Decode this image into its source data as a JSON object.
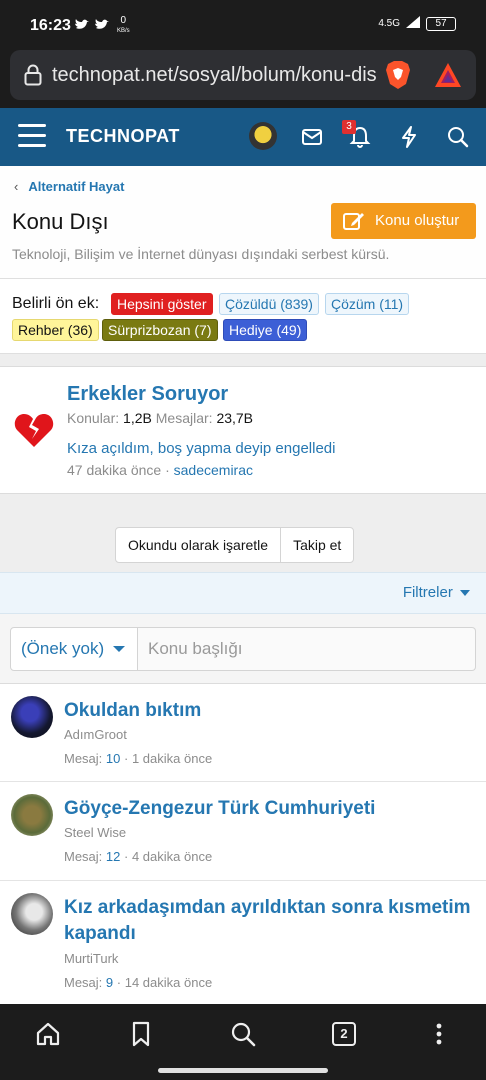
{
  "status": {
    "time": "16:23",
    "data_speed": "0",
    "data_unit": "KB/s",
    "network": "4.5G",
    "battery": "57"
  },
  "browser": {
    "url": "technopat.net/sosyal/bolum/konu-dis"
  },
  "header": {
    "logo": "TECHNOPAT",
    "notification_count": "3"
  },
  "breadcrumb": {
    "label": "Alternatif Hayat"
  },
  "page": {
    "title": "Konu Dışı",
    "create_button": "Konu oluştur",
    "description": "Teknoloji, Bilişim ve İnternet dünyası dışındaki serbest kürsü."
  },
  "prefixes": {
    "label": "Belirli ön ek:",
    "items": [
      {
        "label": "Hepsini göster",
        "bg": "#e02020",
        "fg": "#ffffff",
        "border": "#e02020"
      },
      {
        "label": "Çözüldü (839)",
        "bg": "#eef6fc",
        "fg": "#2577b1",
        "border": "#b7d6ee"
      },
      {
        "label": "Çözüm (11)",
        "bg": "#eef6fc",
        "fg": "#2577b1",
        "border": "#b7d6ee"
      },
      {
        "label": "Rehber (36)",
        "bg": "#fff59a",
        "fg": "#141414",
        "border": "#e6d870"
      },
      {
        "label": "Sürprizbozan (7)",
        "bg": "#7a7a12",
        "fg": "#ffffff",
        "border": "#5e5e0c"
      },
      {
        "label": "Hediye (49)",
        "bg": "#3c5fd6",
        "fg": "#ffffff",
        "border": "#2e4cb8"
      }
    ]
  },
  "forum": {
    "title": "Erkekler Soruyor",
    "topics_label": "Konular:",
    "topics_value": "1,2B",
    "messages_label": "Mesajlar:",
    "messages_value": "23,7B",
    "last_thread": "Kıza açıldım, boş yapma deyip engelledi",
    "last_time": "47 dakika önce",
    "last_user": "sadecemirac"
  },
  "actions": {
    "mark_read": "Okundu olarak işaretle",
    "follow": "Takip et"
  },
  "filters": {
    "label": "Filtreler"
  },
  "search": {
    "prefix_value": "(Önek yok)",
    "placeholder": "Konu başlığı"
  },
  "threads": [
    {
      "title": "Okuldan bıktım",
      "author": "AdımGroot",
      "msg_label": "Mesaj:",
      "count": "10",
      "time": "1 dakika önce"
    },
    {
      "title": "Göyçe-Zengezur Türk Cumhuriyeti",
      "author": "Steel Wise",
      "msg_label": "Mesaj:",
      "count": "12",
      "time": "4 dakika önce"
    },
    {
      "title": "Kız arkadaşımdan ayrıldıktan sonra kısmetim kapandı",
      "author": "MurtiTurk",
      "msg_label": "Mesaj:",
      "count": "9",
      "time": "14 dakika önce"
    }
  ],
  "nav": {
    "tab_count": "2"
  }
}
